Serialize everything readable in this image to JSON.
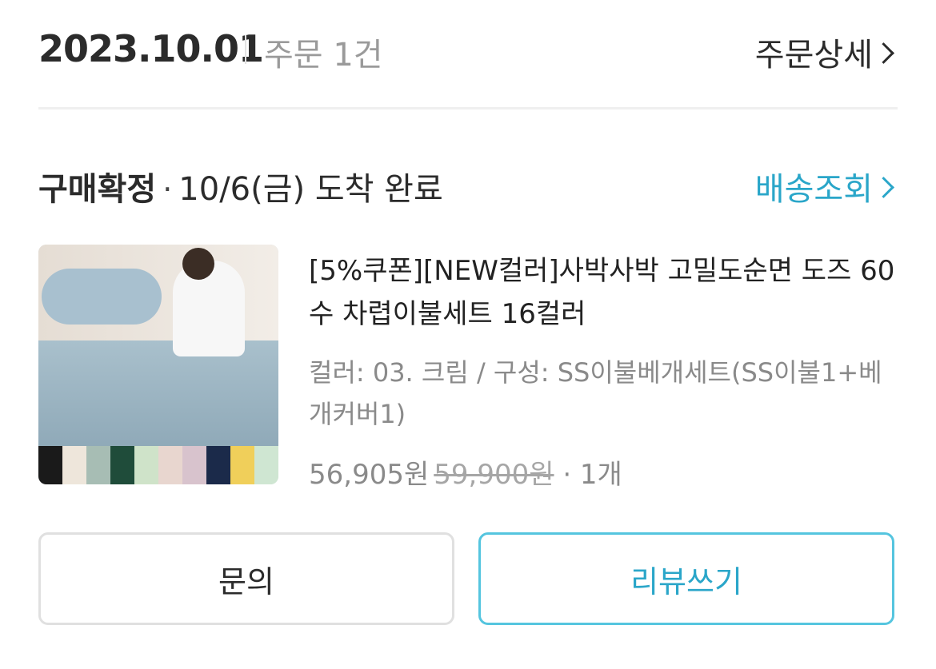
{
  "order": {
    "date": "2023.10.01",
    "count_label": "주문 1건",
    "detail_label": "주문상세"
  },
  "status": {
    "label": "구매확정",
    "separator": "·",
    "text": "10/6(금) 도착 완료",
    "track_label": "배송조회"
  },
  "product": {
    "title": "[5%쿠폰][NEW컬러]사박사박 고밀도순면 도즈 60수 차렵이불세트 16컬러",
    "option": "컬러: 03. 크림 / 구성: SS이불베개세트(SS이불1+베개커버1)",
    "price": "56,905원",
    "original_price": "59,900원",
    "quantity": "· 1개",
    "swatch_colors": [
      "#1a1a1a",
      "#eee6db",
      "#a7bdb4",
      "#1f4c3a",
      "#cfe3c9",
      "#e8d6cf",
      "#d8c3cd",
      "#1b2a4a",
      "#f0cf5a",
      "#cfe6d2"
    ]
  },
  "actions": {
    "inquiry_label": "문의",
    "review_label": "리뷰쓰기"
  },
  "colors": {
    "accent": "#2aa6c9",
    "accent_border": "#55c5df"
  }
}
